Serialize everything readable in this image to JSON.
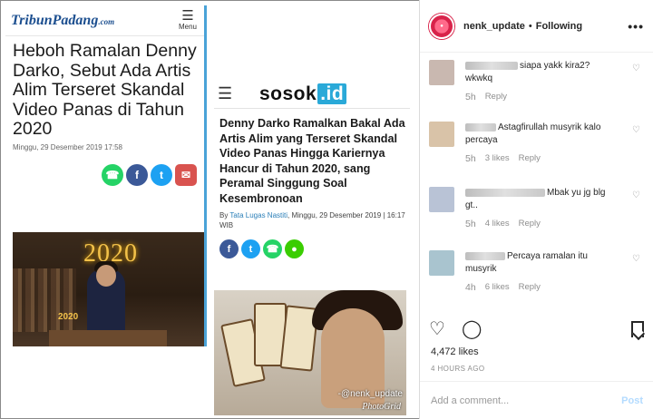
{
  "tribun": {
    "logo": "TribunPadang",
    "logo_suffix": ".com",
    "menu_label": "Menu",
    "headline": "Heboh Ramalan Denny Darko, Sebut Ada Artis Alim Terseret Skandal Video Panas di Tahun 2020",
    "date": "Minggu, 29 Desember 2019 17:58",
    "photo_year": "2020",
    "photo_year_small": "2020",
    "share_icons": [
      "whatsapp-icon",
      "facebook-icon",
      "twitter-icon",
      "comment-icon"
    ]
  },
  "sosok": {
    "logo_main": "sosok",
    "logo_dot": ".id",
    "headline": "Denny Darko Ramalkan Bakal Ada Artis Alim yang Terseret Skandal Video Panas Hingga Kariernya Hancur di Tahun 2020, sang Peramal Singgung Soal Kesembronoan",
    "by_label": "By",
    "author": "Tata Lugas Nastiti",
    "date": ", Minggu, 29 Desember 2019 | 16:17 WIB",
    "watermark": "-@nenk_update",
    "watermark2": "PhotoGrid",
    "share_icons": [
      "facebook-icon",
      "twitter-icon",
      "whatsapp-icon",
      "line-icon"
    ]
  },
  "instagram": {
    "username": "nenk_update",
    "separator": "•",
    "follow_status": "Following",
    "more": "•••",
    "comments": [
      {
        "text": "siapa yakk kira2? wkwkq",
        "age": "5h",
        "likes": "",
        "reply": "Reply",
        "avatar_color": "#c9b8b0"
      },
      {
        "text": "Astagfirullah musyrik kalo percaya",
        "age": "5h",
        "likes": "3 likes",
        "reply": "Reply",
        "avatar_color": "#d9c3a8"
      },
      {
        "text": "Mbak yu jg blg gt..",
        "age": "5h",
        "likes": "4 likes",
        "reply": "Reply",
        "avatar_color": "#b9c3d6"
      },
      {
        "text": "Percaya ramalan itu musyrik",
        "age": "4h",
        "likes": "6 likes",
        "reply": "Reply",
        "avatar_color": "#a9c4cf"
      }
    ],
    "likes": "4,472 likes",
    "time": "4 HOURS AGO",
    "add_comment_placeholder": "Add a comment...",
    "post_label": "Post"
  },
  "colors": {
    "whatsapp": "#25d366",
    "facebook": "#3b5998",
    "twitter": "#1da1f2",
    "comment": "#d9534f",
    "line": "#3acd01",
    "sosok_accent": "#2aa9d8"
  }
}
